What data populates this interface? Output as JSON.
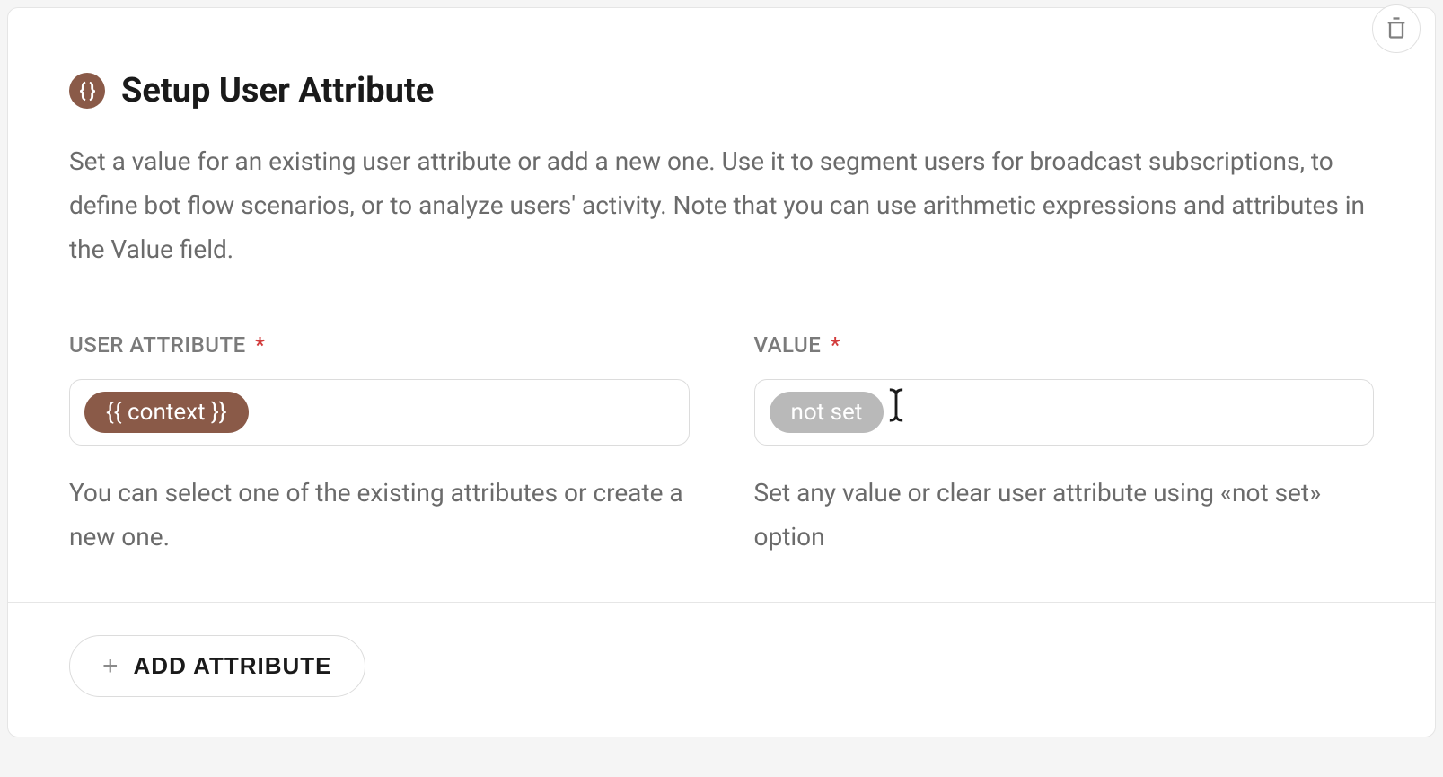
{
  "header": {
    "icon_label": "{ }",
    "title": "Setup User Attribute"
  },
  "description": "Set a value for an existing user attribute or add a new one. Use it to segment users for broadcast subscriptions, to define bot flow scenarios, or to analyze users' activity. Note that you can use arithmetic expressions and attributes in the Value field.",
  "fields": {
    "attribute": {
      "label": "USER ATTRIBUTE",
      "required_marker": "*",
      "chip_text": "{{ context }}",
      "helper": "You can select one of the existing attributes or create a new one."
    },
    "value": {
      "label": "VALUE",
      "required_marker": "*",
      "chip_text": "not set",
      "helper": "Set any value or clear user attribute using «not set» option"
    }
  },
  "footer": {
    "add_button_label": "ADD ATTRIBUTE",
    "add_button_plus": "+"
  }
}
